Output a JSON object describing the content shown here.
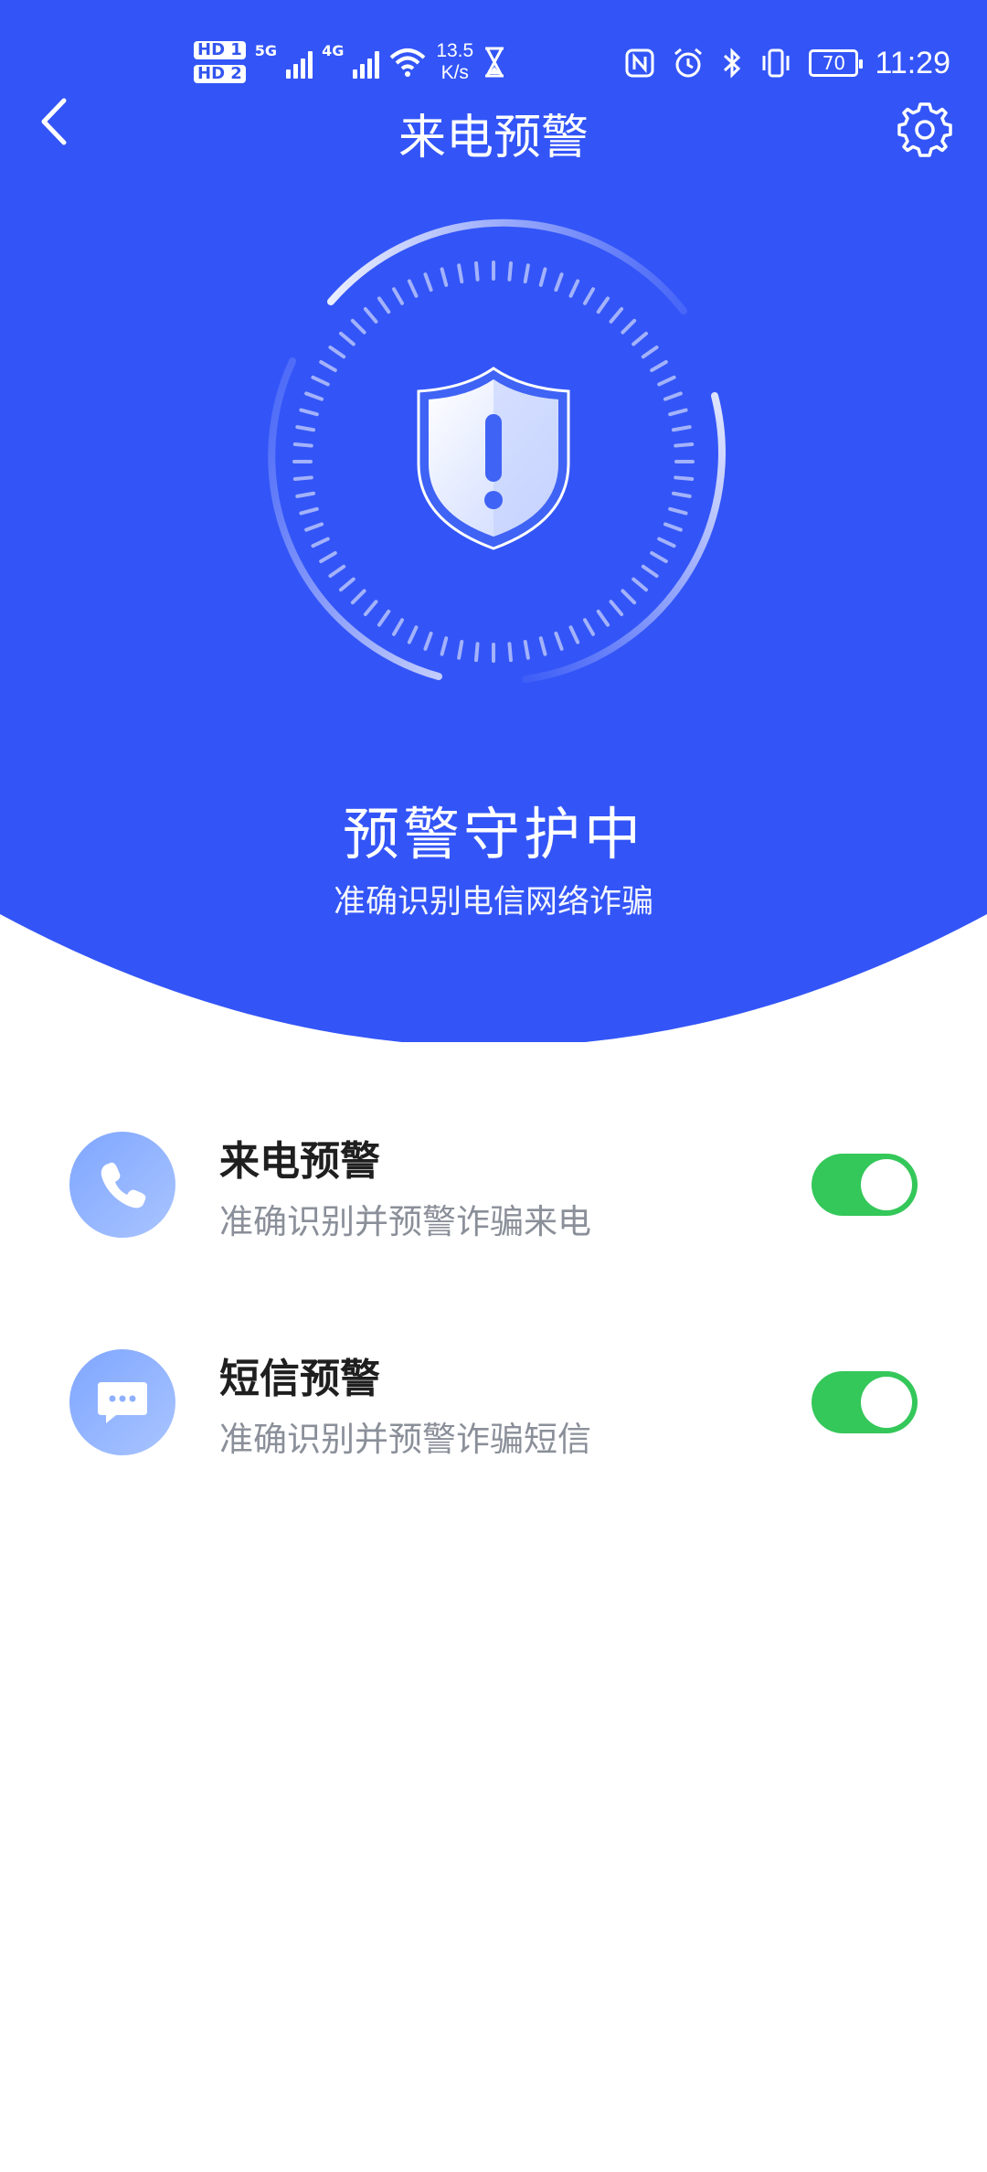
{
  "status_bar": {
    "hd1": "HD 1",
    "hd2": "HD 2",
    "net1": "5G",
    "net2": "4G",
    "speed_value": "13.5",
    "speed_unit": "K/s",
    "battery": "70",
    "time": "11:29"
  },
  "header": {
    "title": "来电预警"
  },
  "protection": {
    "title": "预警守护中",
    "subtitle": "准确识别电信网络诈骗"
  },
  "settings_list": [
    {
      "title": "来电预警",
      "subtitle": "准确识别并预警诈骗来电",
      "enabled": true
    },
    {
      "title": "短信预警",
      "subtitle": "准确识别并预警诈骗短信",
      "enabled": true
    }
  ],
  "colors": {
    "primary": "#3355f7",
    "toggle_on": "#34c759",
    "icon_bg": "#8fb0ff"
  },
  "icons": [
    "back-icon",
    "settings-gear-icon",
    "shield-alert-icon",
    "phone-icon",
    "message-icon"
  ]
}
